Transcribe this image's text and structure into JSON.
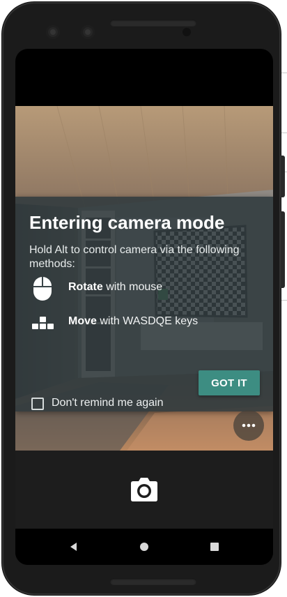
{
  "app": {
    "name": "camera-mode-onboarding"
  },
  "dialog": {
    "title": "Entering camera mode",
    "subtitle": "Hold Alt to control camera via the following methods:",
    "methods": [
      {
        "icon": "mouse-icon",
        "action": "Rotate",
        "detail": " with mouse"
      },
      {
        "icon": "keys-icon",
        "action": "Move",
        "detail": " with WASDQE keys"
      }
    ],
    "remind_label": "Don't remind me again",
    "remind_checked": false,
    "confirm_label": "GOT IT"
  },
  "colors": {
    "dialog_bg": "#303a3e",
    "accent_button": "#3d8d82",
    "control_bar": "#1d1d1d",
    "phone_body": "#1b1b1b"
  },
  "icons": {
    "more": "more-horizontal-icon",
    "capture": "camera-icon",
    "back": "nav-back-icon",
    "home": "nav-home-icon",
    "recents": "nav-recents-icon"
  }
}
